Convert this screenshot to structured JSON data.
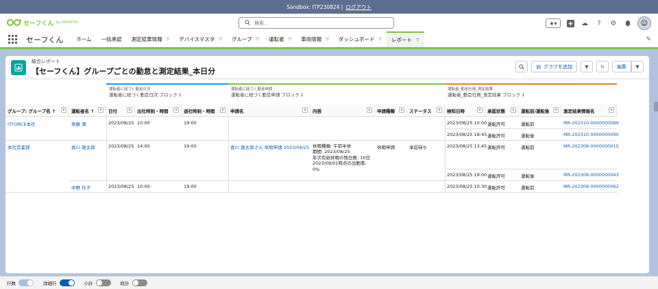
{
  "sandbox": {
    "label": "Sandbox: ITP230824 |",
    "logout": "ログアウト"
  },
  "header": {
    "logo_text": "セーフくん",
    "logo_sub": "by DAIHATSU",
    "search_placeholder": "検索..."
  },
  "nav": {
    "app_name": "セーフくん",
    "items": [
      {
        "label": "ホーム",
        "chevron": false
      },
      {
        "label": "一括承認",
        "chevron": false
      },
      {
        "label": "測定結果情報",
        "chevron": true
      },
      {
        "label": "デバイスマスタ",
        "chevron": true
      },
      {
        "label": "グループ",
        "chevron": true
      },
      {
        "label": "運転者",
        "chevron": true
      },
      {
        "label": "車両情報",
        "chevron": true
      },
      {
        "label": "ダッシュボード",
        "chevron": true
      },
      {
        "label": "レポート",
        "chevron": true
      }
    ]
  },
  "report": {
    "type": "結合レポート",
    "title": "【セーフくん】グループごとの勤怠と測定結果_本日分",
    "actions": {
      "add_chart": "グラフを追加",
      "edit": "編集"
    }
  },
  "blocks": [
    {
      "sub": "運転者に紐づく勤怠日次",
      "name": "運転者に紐づく勤怠日次 ブロック 1",
      "color": "#1b96ff"
    },
    {
      "sub": "運転者に紐づく勤怠申請",
      "name": "運転者に紐づく勤怠申請 ブロック 1",
      "color": "#7cc241"
    },
    {
      "sub": "運転者_勤怠社員_測定結果",
      "name": "運転者_勤怠社員_測定結果 ブロック 1",
      "color": "#e67e22"
    }
  ],
  "columns": {
    "group": "グループ: グループ名 ↑",
    "driver": "運転者名 ↑",
    "date": "日付",
    "clock_in": "出社時刻・時間",
    "clock_out": "退社時刻・時間",
    "app_name": "申請名",
    "content": "内容",
    "app_type": "申請種類",
    "status": "ステータス",
    "check_time": "検知日時",
    "approval": "承認状態",
    "before_after": "運転前/運転後",
    "result_name": "測定結果情報名"
  },
  "rows": {
    "r1": {
      "group": "ITFORCE本社",
      "driver": "斎藤 満",
      "date": "2023/08/25",
      "in": "10:00",
      "out": "19:00",
      "m": [
        {
          "time": "2023/08/25 10:00",
          "approval": "運転許可",
          "ba": "運転前",
          "name": "MR-202310-0000000089"
        },
        {
          "time": "2023/08/25 18:45",
          "approval": "運転許可",
          "ba": "運転後",
          "name": "MR-202310-0000000090"
        }
      ]
    },
    "r2": {
      "group": "本社営業部",
      "driver": "香川 雄太郎",
      "date": "2023/08/25",
      "in": "14:00",
      "out": "19:00",
      "app_name": "香川 雄太郎さん 休暇申請 2023/08/25",
      "content": [
        "休暇種類: 午前半休",
        "期間: 2023/08/25",
        "年次有給休暇の残日数: 10日",
        "2023/09/01時点の出勤率: 0%"
      ],
      "app_type": "休暇申請",
      "status": "承認待ち",
      "m": [
        {
          "time": "2023/08/25 13:45",
          "approval": "運転許可",
          "ba": "運転前",
          "name": "MR-202308-0000000015"
        },
        {
          "time": "2023/08/25 19:00",
          "approval": "運転許可",
          "ba": "運転後",
          "name": "MR-202308-0000000043"
        }
      ]
    },
    "r3": {
      "driver": "中野 玲子",
      "date": "2023/08/25",
      "in": "10:00",
      "out": "19:00",
      "m": [
        {
          "time": "2023/08/25 10:30",
          "approval": "運転許可",
          "ba": "運転前",
          "name": "MR-202308-0000000062"
        }
      ]
    }
  },
  "footer": {
    "row_count": "行数",
    "detail_rows": "詳細行",
    "subtotals": "小計",
    "grand_total": "総計"
  }
}
